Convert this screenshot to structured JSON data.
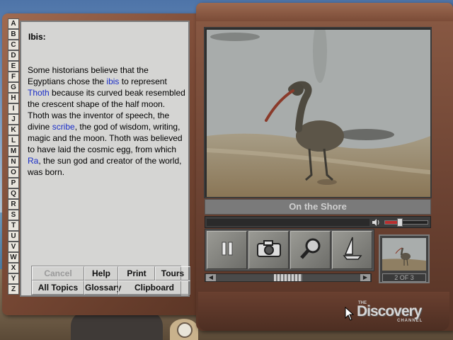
{
  "alphabet": [
    "A",
    "B",
    "C",
    "D",
    "E",
    "F",
    "G",
    "H",
    "I",
    "J",
    "K",
    "L",
    "M",
    "N",
    "O",
    "P",
    "Q",
    "R",
    "S",
    "T",
    "U",
    "V",
    "W",
    "X",
    "Y",
    "Z"
  ],
  "article": {
    "title": "Ibis:",
    "segments": [
      {
        "text": "Some historians believe that the Egyptians chose the ",
        "link": false
      },
      {
        "text": "ibis",
        "link": true
      },
      {
        "text": " to represent ",
        "link": false
      },
      {
        "text": "Thoth",
        "link": true
      },
      {
        "text": " because its curved beak resembled the crescent shape of the half moon. Thoth was the inventor of speech, the divine ",
        "link": false
      },
      {
        "text": "scribe",
        "link": true
      },
      {
        "text": ", the god of wisdom, writing, magic and the moon. Thoth was believed to have laid the cosmic egg, from which ",
        "link": false
      },
      {
        "text": "Ra",
        "link": true
      },
      {
        "text": ", the sun god and creator of the world, was born.",
        "link": false
      }
    ]
  },
  "buttons": {
    "cancel": "Cancel",
    "help": "Help",
    "print": "Print",
    "tours": "Tours",
    "all_topics": "All Topics",
    "glossary": "Glossary",
    "clipboard": "Clipboard"
  },
  "media": {
    "caption": "On the Shore",
    "page_indicator": "2 OF 3",
    "volume_level": 0.28,
    "progress_level": 0.0
  },
  "icons": {
    "pause": "pause-icon",
    "snapshot": "camera-icon",
    "zoom": "magnifier-icon",
    "tour": "sailboat-icon",
    "volume": "speaker-icon"
  },
  "logo": {
    "the": "THE",
    "name": "Discovery",
    "channel": "CHANNEL"
  },
  "colors": {
    "link": "#1a2ec8",
    "panel": "#d5d5d3",
    "frame": "#7a4a36",
    "volume_fill": "#bb2e2e"
  }
}
